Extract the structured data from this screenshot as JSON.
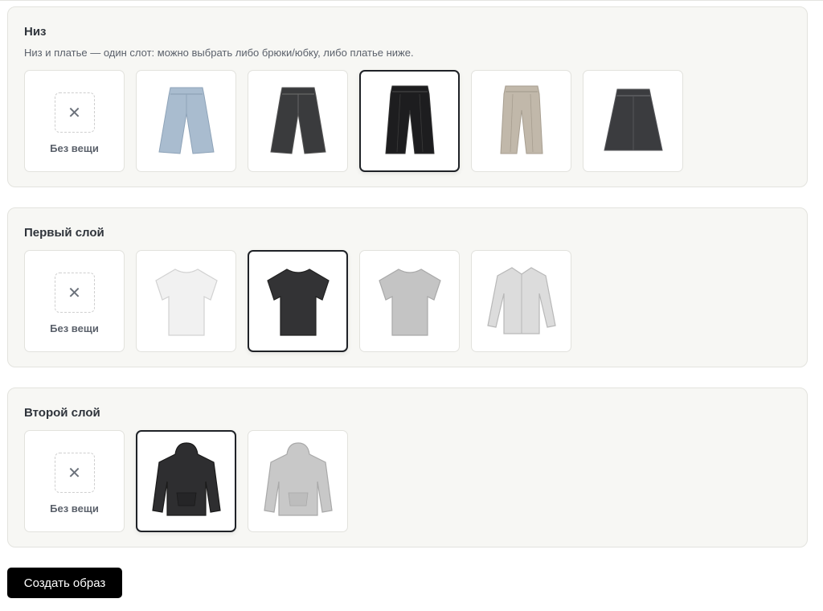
{
  "sections": {
    "bottom": {
      "title": "Низ",
      "hint": "Низ и платье — один слот: можно выбрать либо брюки/юбку, либо платье ниже.",
      "none_label": "Без вещи",
      "selected_index": 3,
      "items": [
        {
          "icon": "light-wide-jeans-icon",
          "color": "#a9bccf"
        },
        {
          "icon": "dark-wide-jeans-icon",
          "color": "#3a3b3d"
        },
        {
          "icon": "black-pleated-trousers-icon",
          "color": "#1d1d1f"
        },
        {
          "icon": "beige-trousers-icon",
          "color": "#c1b8aa"
        },
        {
          "icon": "denim-skirt-icon",
          "color": "#3b3c3f"
        }
      ]
    },
    "layer1": {
      "title": "Первый слой",
      "none_label": "Без вещи",
      "selected_index": 2,
      "items": [
        {
          "icon": "white-tshirt-icon",
          "color": "#f1f1f1"
        },
        {
          "icon": "black-tshirt-icon",
          "color": "#333335"
        },
        {
          "icon": "grey-tshirt-icon",
          "color": "#c4c4c4"
        },
        {
          "icon": "light-shirt-icon",
          "color": "#dcdcdc"
        }
      ]
    },
    "layer2": {
      "title": "Второй слой",
      "none_label": "Без вещи",
      "selected_index": 1,
      "items": [
        {
          "icon": "black-hoodie-icon",
          "color": "#2e2e30"
        },
        {
          "icon": "grey-hoodie-icon",
          "color": "#c8c8c8"
        }
      ]
    }
  },
  "none_symbol": "✕",
  "create_button": "Создать образ"
}
